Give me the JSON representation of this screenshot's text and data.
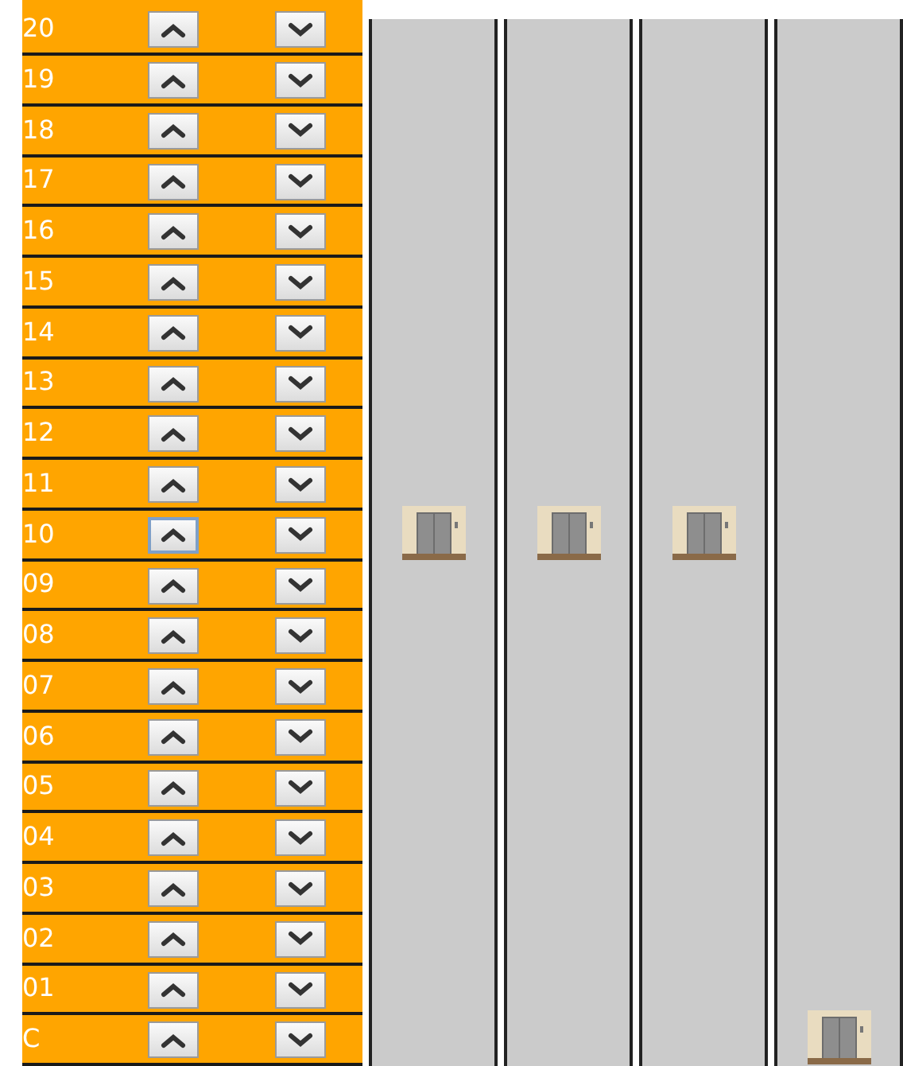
{
  "floors": [
    {
      "label": "20",
      "up_focused": false
    },
    {
      "label": "19",
      "up_focused": false
    },
    {
      "label": "18",
      "up_focused": false
    },
    {
      "label": "17",
      "up_focused": false
    },
    {
      "label": "16",
      "up_focused": false
    },
    {
      "label": "15",
      "up_focused": false
    },
    {
      "label": "14",
      "up_focused": false
    },
    {
      "label": "13",
      "up_focused": false
    },
    {
      "label": "12",
      "up_focused": false
    },
    {
      "label": "11",
      "up_focused": false
    },
    {
      "label": "10",
      "up_focused": true
    },
    {
      "label": "09",
      "up_focused": false
    },
    {
      "label": "08",
      "up_focused": false
    },
    {
      "label": "07",
      "up_focused": false
    },
    {
      "label": "06",
      "up_focused": false
    },
    {
      "label": "05",
      "up_focused": false
    },
    {
      "label": "04",
      "up_focused": false
    },
    {
      "label": "03",
      "up_focused": false
    },
    {
      "label": "02",
      "up_focused": false
    },
    {
      "label": "01",
      "up_focused": false
    },
    {
      "label": "C",
      "up_focused": false
    }
  ],
  "shafts": [
    {
      "level": 0.5
    },
    {
      "level": 0.5
    },
    {
      "level": 0.5
    },
    {
      "level": 0
    }
  ]
}
